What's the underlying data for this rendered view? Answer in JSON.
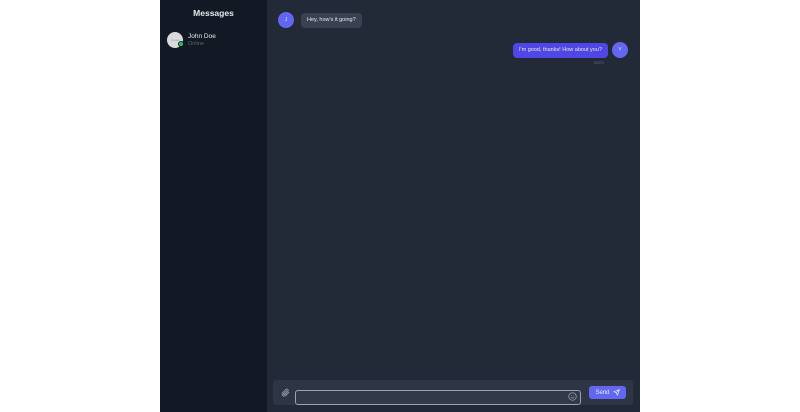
{
  "sidebar": {
    "title": "Messages",
    "contacts": [
      {
        "name": "John Doe",
        "status": "Online",
        "avatar_alt": "Avatar"
      }
    ]
  },
  "chat": {
    "messages": [
      {
        "direction": "incoming",
        "avatar_initial": "J",
        "text": "Hey, how's it going?"
      },
      {
        "direction": "outgoing",
        "avatar_initial": "Y",
        "text": "I'm good, thanks! How about you?",
        "time": "Seen"
      }
    ]
  },
  "composer": {
    "input_value": "",
    "input_placeholder": "",
    "send_label": "Send",
    "attach_icon": "paperclip-icon",
    "emoji_icon": "smile-icon",
    "send_icon": "paper-plane-icon"
  },
  "colors": {
    "sidebar_bg": "#131924",
    "main_bg": "#222a38",
    "accent": "#6366f1",
    "online": "#22c55e"
  }
}
